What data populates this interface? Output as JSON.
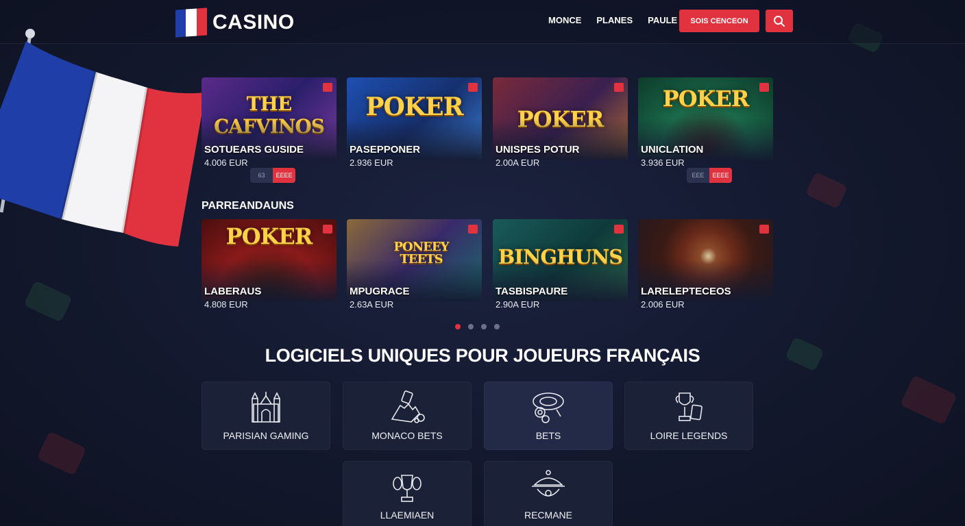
{
  "brand": {
    "name": "CASINO",
    "flag_colors": [
      "#1f3ea8",
      "#ffffff",
      "#e0323f"
    ]
  },
  "nav": {
    "items": [
      "MONCE",
      "PLANES",
      "PAULE"
    ],
    "cta_label": "SOIS CENCEON",
    "search_icon": "search-icon"
  },
  "featured": {
    "cards": [
      {
        "art": "THE CAFVINOS",
        "name": "SOTUEARS GUSIDE",
        "price": "4.006 EUR"
      },
      {
        "art": "POKER",
        "name": "PASEPPONER",
        "price": "2.936 EUR"
      },
      {
        "art": "POKER",
        "name": "UNISPES POTUR",
        "price": "2.00A EUR"
      },
      {
        "art": "POKER",
        "name": "UNICLATION",
        "price": "3.936 EUR"
      }
    ],
    "pill_left": {
      "a": "63",
      "b": "EEEE"
    },
    "pill_right": {
      "a": "EEE",
      "b": "EEEE"
    }
  },
  "section": {
    "title": "PARREANDAUNS",
    "cards": [
      {
        "art": "POKER",
        "name": "LABERAUS",
        "price": "4.808 EUR"
      },
      {
        "art": "PONEEY TEETS",
        "name": "MPUGRACE",
        "price": "2.63A EUR"
      },
      {
        "art": "BINGHUNS",
        "name": "TASBISPAURE",
        "price": "2.90A EUR"
      },
      {
        "art": "",
        "name": "LARELEPTECEOS",
        "price": "2.006 EUR"
      }
    ]
  },
  "pagination": {
    "count": 4,
    "active": 1
  },
  "software": {
    "heading": "LOGICIELS UNIQUES POUR JOUEURS FRANÇAIS",
    "tiles": [
      {
        "label": "PARISIAN GAMING",
        "icon": "castle-icon"
      },
      {
        "label": "MONACO BETS",
        "icon": "dealer-hand-icon"
      },
      {
        "label": "BETS",
        "icon": "chips-icon"
      },
      {
        "label": "LOIRE LEGENDS",
        "icon": "trophy-cards-icon"
      },
      {
        "label": "LLAEMIAEN",
        "icon": "trophy-icon"
      },
      {
        "label": "RECMANE",
        "icon": "cloche-icon"
      }
    ]
  },
  "colors": {
    "accent": "#e0323f",
    "gold": "#ffd24a",
    "background": "#141a30",
    "tile": "#1b2238"
  }
}
